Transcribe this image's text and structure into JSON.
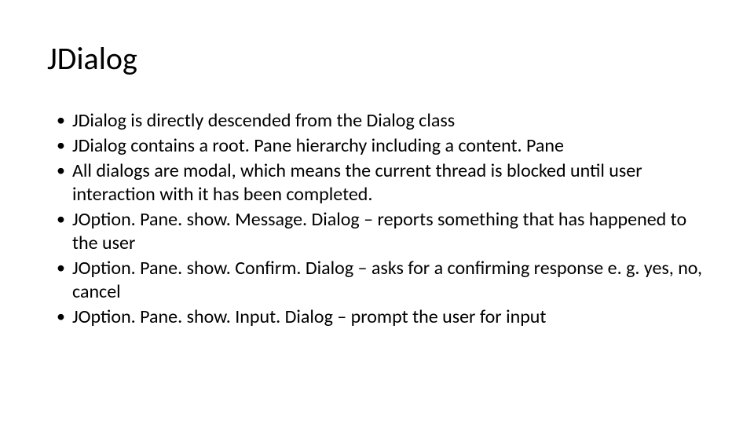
{
  "slide": {
    "title": "JDialog",
    "bullets": [
      "JDialog is directly descended from the Dialog class",
      "JDialog contains a root. Pane hierarchy including a content. Pane",
      "All dialogs are modal, which means the current thread is blocked until user interaction with it has been completed.",
      "JOption. Pane. show. Message. Dialog – reports something that has happened to the user",
      "JOption. Pane. show. Confirm. Dialog – asks for a confirming response e. g. yes, no, cancel",
      "JOption. Pane. show. Input. Dialog – prompt the user for input"
    ]
  }
}
